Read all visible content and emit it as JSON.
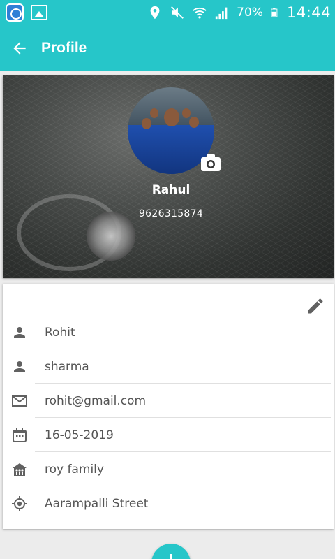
{
  "status_bar": {
    "battery_percent": "70%",
    "time": "14:44"
  },
  "toolbar": {
    "title": "Profile"
  },
  "profile": {
    "name": "Rahul",
    "phone": "9626315874"
  },
  "details": [
    {
      "icon": "person-icon",
      "value": "Rohit"
    },
    {
      "icon": "person-icon",
      "value": "sharma"
    },
    {
      "icon": "email-icon",
      "value": "rohit@gmail.com"
    },
    {
      "icon": "calendar-icon",
      "value": "16-05-2019"
    },
    {
      "icon": "family-icon",
      "value": "roy family"
    },
    {
      "icon": "location-icon",
      "value": "Aarampalli Street"
    }
  ],
  "colors": {
    "accent": "#26c6c9",
    "icon_gray": "#616161",
    "text_gray": "#555555"
  }
}
